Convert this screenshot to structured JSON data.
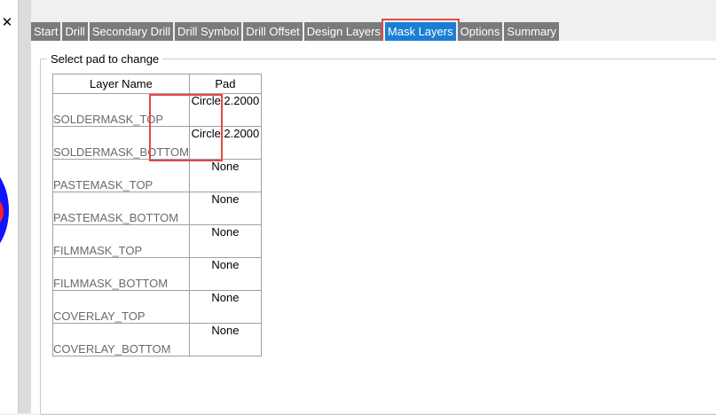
{
  "window": {
    "close_glyph": "✕"
  },
  "tabs": [
    {
      "label": "Start",
      "active": false
    },
    {
      "label": "Drill",
      "active": false
    },
    {
      "label": "Secondary Drill",
      "active": false
    },
    {
      "label": "Drill Symbol",
      "active": false
    },
    {
      "label": "Drill Offset",
      "active": false
    },
    {
      "label": "Design Layers",
      "active": false
    },
    {
      "label": "Mask Layers",
      "active": true
    },
    {
      "label": "Options",
      "active": false
    },
    {
      "label": "Summary",
      "active": false
    }
  ],
  "group": {
    "title": "Select pad to change",
    "columns": [
      "Layer Name",
      "Pad"
    ],
    "rows": [
      {
        "layer": "SOLDERMASK_TOP",
        "pad": "Circle 2.2000"
      },
      {
        "layer": "SOLDERMASK_BOTTOM",
        "pad": "Circle 2.2000"
      },
      {
        "layer": "PASTEMASK_TOP",
        "pad": "None"
      },
      {
        "layer": "PASTEMASK_BOTTOM",
        "pad": "None"
      },
      {
        "layer": "FILMMASK_TOP",
        "pad": "None"
      },
      {
        "layer": "FILMMASK_BOTTOM",
        "pad": "None"
      },
      {
        "layer": "COVERLAY_TOP",
        "pad": "None"
      },
      {
        "layer": "COVERLAY_BOTTOM",
        "pad": "None"
      }
    ]
  },
  "colors": {
    "tab_bg": "#7b7b7b",
    "tab_active_bg": "#1a7fd4",
    "highlight": "#e34848",
    "canvas_outer": "#1212ff",
    "canvas_inner": "#ff2020"
  }
}
